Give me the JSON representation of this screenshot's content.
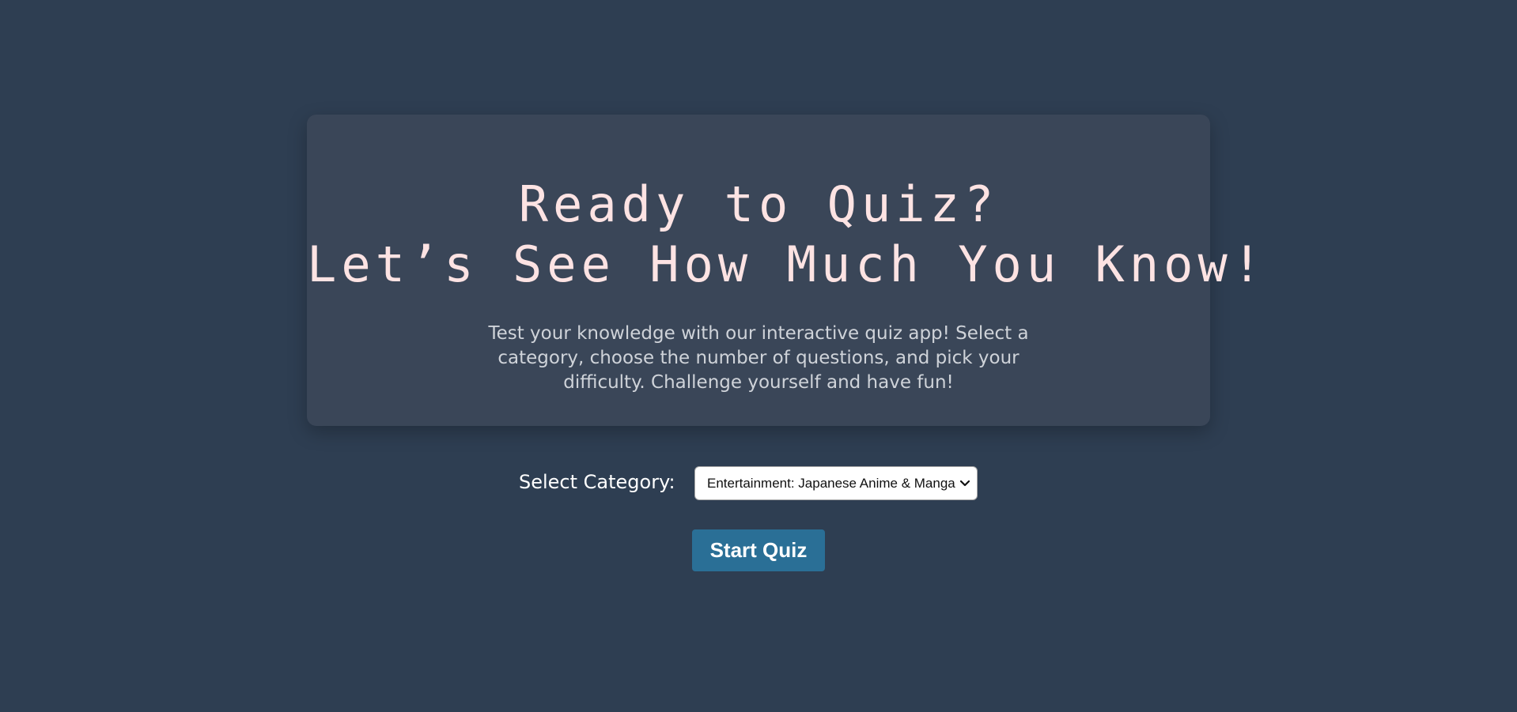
{
  "hero": {
    "title_line1": "Ready to Quiz?",
    "title_line2": "Let’s See How Much You Know!",
    "description": "Test your knowledge with our interactive quiz app! Select a category, choose the number of questions, and pick your difficulty. Challenge yourself and have fun!"
  },
  "category": {
    "label": "Select Category:",
    "selected": "Entertainment: Japanese Anime & Manga",
    "icon": "chevron-down-icon"
  },
  "start_button": {
    "label": "Start Quiz"
  },
  "colors": {
    "page_background": "#2e3e52",
    "card_background": "#3a4658",
    "title_color": "#fde3e3",
    "description_color": "#cfd3d9",
    "button_background": "#2a6f96"
  }
}
